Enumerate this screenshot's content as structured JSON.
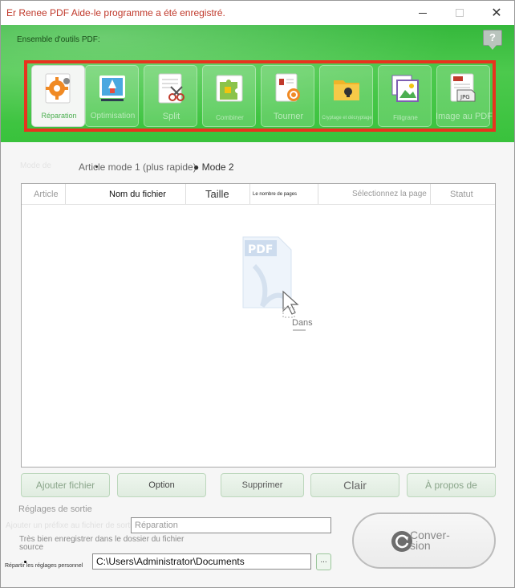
{
  "window": {
    "title": "Er Renee PDF Aide-le programme a été enregistré.",
    "minimize_icon": "minimize-icon",
    "maximize_icon": "maximize-icon",
    "close_symbol": "✕"
  },
  "banner": {
    "toolset_label": "Ensemble d'outils PDF:",
    "help_symbol": "?",
    "tools": [
      {
        "label": "Réparation",
        "icon": "repair-gear-icon",
        "active": true
      },
      {
        "label": "Optimisation",
        "icon": "rocket-icon",
        "active": false
      },
      {
        "label": "Split",
        "icon": "scissors-icon",
        "active": false
      },
      {
        "label": "Combiner",
        "icon": "puzzle-icon",
        "active": false
      },
      {
        "label": "Tourner",
        "icon": "rotate-icon",
        "active": false
      },
      {
        "label": "Cryptage et décryptage",
        "icon": "lock-icon",
        "active": false
      },
      {
        "label": "Filigrane",
        "icon": "image-watermark-icon",
        "active": false
      },
      {
        "label": "Image au PDF",
        "icon": "jpg-to-pdf-icon",
        "active": false
      }
    ],
    "accent_color": "#e8331e",
    "green_color": "#3cbf3f"
  },
  "mode": {
    "ghost_label": "Mode de",
    "mode1_label": "Article mode 1 (plus rapide)",
    "mode2_label": "● Mode 2"
  },
  "table": {
    "headers": [
      "Article",
      "Nom du fichier",
      "Taille",
      "Le nombre de pages",
      "Sélectionnez la page",
      "Statut"
    ],
    "rows": [],
    "drop_hint": "Dans"
  },
  "buttons": {
    "add_file": "Ajouter fichier",
    "option": "Option",
    "delete": "Supprimer",
    "clear": "Clair",
    "about": "À propos de"
  },
  "output": {
    "title": "Réglages de sortie",
    "prefix_option": "Ajouter un préfixe au fichier de sortie",
    "prefix_value": "Réparation",
    "save_option": "Très bien enregistrer dans le dossier du fichier source",
    "personal_option": "Répartir les réglages personnel",
    "path_value": "C:\\Users\\Administrator\\Documents",
    "browse_label": "...",
    "convert_label": "Conver-sion"
  }
}
